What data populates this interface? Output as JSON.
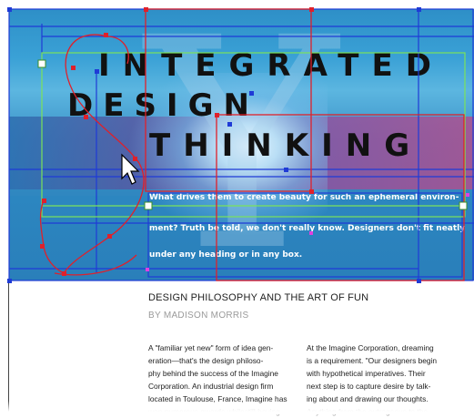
{
  "banner": {
    "title_line1": "INTEGRATED",
    "title_line2": "DESIGN",
    "title_line3": "THINKING",
    "overlay_line1": "What drives them to create beauty for such an ephemeral environ-",
    "overlay_line2": "ment? Truth be told, we don't really know. Designers don't fit neatly",
    "overlay_line3": "under any heading or in any box."
  },
  "article": {
    "headline": "DESIGN PHILOSOPHY AND THE ART OF FUN",
    "byline": "BY MADISON MORRIS",
    "col1_lines": [
      "A \"familiar yet new\" form of idea gen-",
      "eration—that's the design philoso-",
      "phy behind the success of the Imagine",
      "Corporation. An industrial design firm",
      "located in Toulouse, France, Imagine has",
      "won numerous awards whilestill having"
    ],
    "col2_lines": [
      "At the Imagine Corporation, dreaming",
      "is a requirement. \"Our designers begin",
      "with hypothetical imperatives. Their",
      "next step is to capture desire by talk-",
      "ing about and drawing our thoughts.",
      "Anything from the outrageous to the"
    ]
  },
  "colors": {
    "frame_blue": "#1f3bd6",
    "path_red": "#e0202a",
    "guide_green": "#7be35a",
    "anchor_magenta": "#e040e0"
  },
  "icons": {
    "cursor": "arrow-pointer-icon"
  }
}
